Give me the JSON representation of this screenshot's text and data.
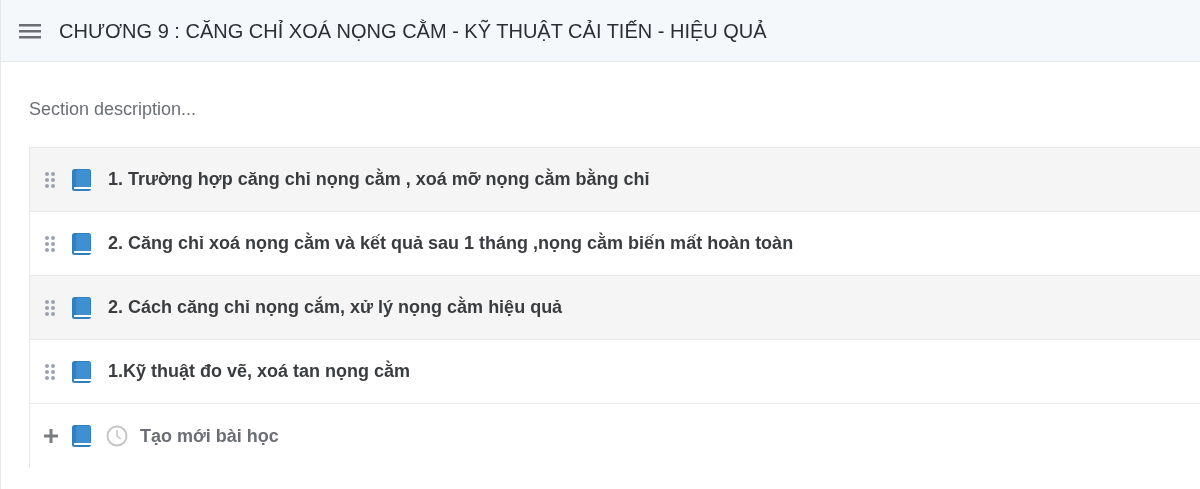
{
  "section": {
    "title": "CHƯƠNG 9 : CĂNG CHỈ XOÁ NỌNG CẰM - KỸ THUẬT CẢI TIẾN - HIỆU QUẢ",
    "description_placeholder": "Section description..."
  },
  "lessons": [
    {
      "title": "1. Trường hợp căng chỉ nọng cằm , xoá mỡ nọng cằm bằng chỉ"
    },
    {
      "title": "2. Căng chỉ xoá nọng cằm và kết quả sau 1 tháng ,nọng cằm biến mất hoàn toàn"
    },
    {
      "title": "2. Cách căng chỉ nọng cắm, xử lý nọng cằm hiệu quả"
    },
    {
      "title": "1.Kỹ thuật đo vẽ, xoá tan nọng cằm"
    }
  ],
  "new_lesson": {
    "label": "Tạo mới bài học"
  }
}
